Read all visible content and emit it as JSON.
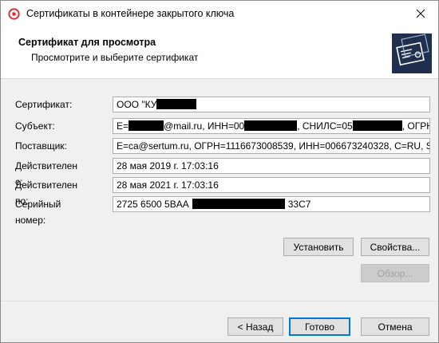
{
  "window": {
    "title": "Сертификаты в контейнере закрытого ключа",
    "close_glyph": "✕",
    "app_icon": "cryptopro-logo-icon"
  },
  "header": {
    "title": "Сертификат для просмотра",
    "subtitle": "Просмотрите и выберите сертификат",
    "graphic_icon": "certificate-icon"
  },
  "fields": {
    "certificate": {
      "label": "Сертификат:",
      "v1": "ООО \"КУ"
    },
    "subject": {
      "label": "Субъект:",
      "v1": "E=",
      "v2": "@mail.ru, ИНН=00",
      "v3": ", СНИЛС=05",
      "v4": ", ОГРН"
    },
    "issuer": {
      "label": "Поставщик:",
      "value": "E=ca@sertum.ru, ОГРН=1116673008539, ИНН=006673240328, C=RU, S"
    },
    "valid_from": {
      "label": "Действителен с:",
      "value": "28 мая 2019 г. 17:03:16"
    },
    "valid_to": {
      "label": "Действителен по:",
      "value": "28 мая 2021 г. 17:03:16"
    },
    "serial": {
      "label": "Серийный номер:",
      "v1": "2725 6500 5BAA",
      "v2": "33C7"
    }
  },
  "buttons": {
    "install": "Установить",
    "properties": "Свойства...",
    "browse": "Обзор...",
    "back": "< Назад",
    "finish": "Готово",
    "cancel": "Отмена"
  },
  "colors": {
    "accent": "#0078d7",
    "cert_graphic_bg": "#1f2f4d",
    "logo_red": "#e3262a"
  }
}
